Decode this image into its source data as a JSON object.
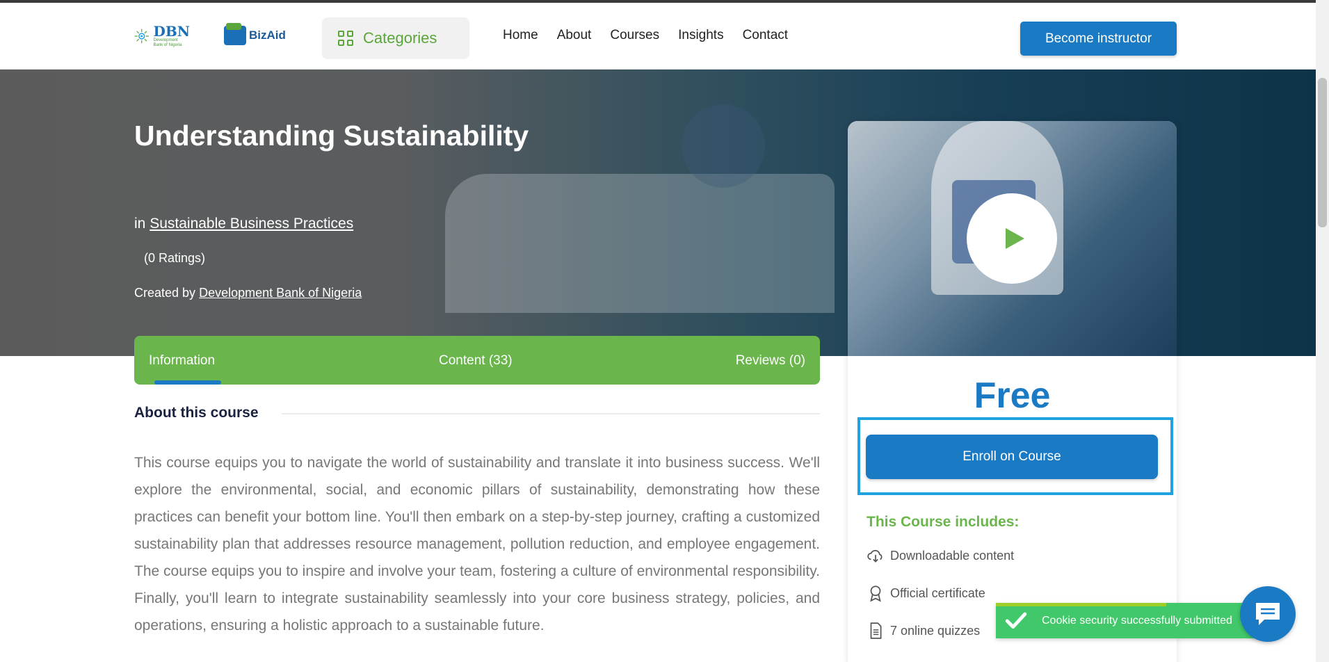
{
  "header": {
    "dbn_logo_text": "DBN",
    "dbn_logo_subtext": "Development Bank of Nigeria",
    "bizaid_logo_text": "BizAid",
    "categories_label": "Categories",
    "nav": [
      "Home",
      "About",
      "Courses",
      "Insights",
      "Contact"
    ],
    "become_instructor_label": "Become instructor"
  },
  "hero": {
    "title": "Understanding Sustainability",
    "in_prefix": "in",
    "category": "Sustainable Business Practices",
    "ratings": "(0 Ratings)",
    "created_prefix": "Created by",
    "creator": "Development Bank of Nigeria"
  },
  "tabs": {
    "information": "Information",
    "content": "Content (33)",
    "reviews": "Reviews (0)",
    "active": "Information"
  },
  "about": {
    "heading": "About this course",
    "text": "This course equips you to navigate the world of sustainability and translate it into business success. We'll explore the environmental, social, and economic pillars of sustainability, demonstrating how these practices can benefit your bottom line. You'll then embark on a step-by-step journey, crafting a customized sustainability plan that addresses resource management, pollution reduction, and employee engagement. The course equips you to inspire and involve your team, fostering a culture of environmental responsibility. Finally, you'll learn to integrate sustainability seamlessly into your core business strategy, policies, and operations, ensuring a holistic approach to a sustainable future."
  },
  "sidebar": {
    "price": "Free",
    "enroll_label": "Enroll on Course",
    "includes_heading": "This Course includes:",
    "includes": [
      {
        "icon": "download-cloud-icon",
        "label": "Downloadable content"
      },
      {
        "icon": "certificate-icon",
        "label": "Official certificate"
      },
      {
        "icon": "document-icon",
        "label": "7 online quizzes"
      }
    ]
  },
  "toast": {
    "message": "Cookie security successfully submitted"
  },
  "colors": {
    "brand_blue": "#1b7ac4",
    "brand_green": "#6ab64c",
    "toast_green": "#41c86a",
    "focus_outline": "#1ea3e0"
  }
}
